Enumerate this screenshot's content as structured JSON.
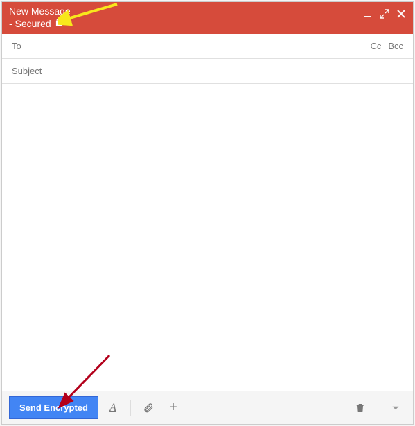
{
  "header": {
    "title": "New Message",
    "subtitle": "- Secured"
  },
  "recipients": {
    "to_label": "To",
    "cc_label": "Cc",
    "bcc_label": "Bcc"
  },
  "subject": {
    "placeholder": "Subject"
  },
  "footer": {
    "send_label": "Send Encrypted"
  },
  "colors": {
    "header_bg": "#d64b3b",
    "send_bg": "#4285f4"
  }
}
